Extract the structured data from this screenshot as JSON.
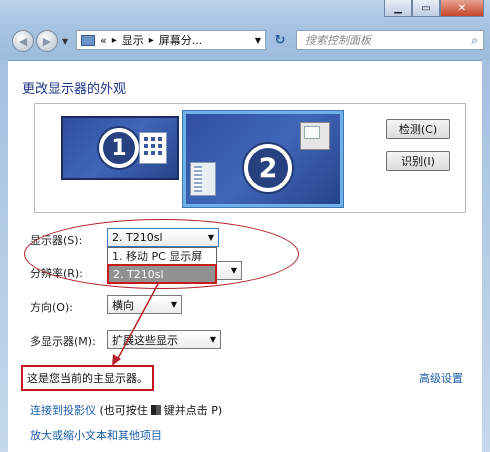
{
  "addressbar": {
    "overflow": "«",
    "crumbs": [
      "显示",
      "屏幕分..."
    ]
  },
  "search": {
    "placeholder": "搜索控制面板"
  },
  "page": {
    "title": "更改显示器的外观"
  },
  "arrangement": {
    "monitor1_number": "1",
    "monitor2_number": "2",
    "detect_label": "检测(C)",
    "identify_label": "识别(I)"
  },
  "settings": {
    "display": {
      "label": "显示器(S):",
      "value": "2. T210sl"
    },
    "display_options": [
      "1. 移动 PC 显示屏",
      "2. T210sl"
    ],
    "resolution": {
      "label": "分辨率(R):"
    },
    "orientation": {
      "label": "方向(O):",
      "value": "横向"
    },
    "multi": {
      "label": "多显示器(M):",
      "value": "扩展这些显示"
    }
  },
  "note": "这是您当前的主显示器。",
  "advanced_link": "高级设置",
  "links": {
    "projector": "连接到投影仪",
    "projector_hint_prefix": "(也可按住",
    "projector_hint_suffix": "键并点击 P)",
    "text_size": "放大或缩小文本和其他项目"
  },
  "colors": {
    "title": "#1e3287",
    "link": "#1b5eab",
    "annotation": "#c4161c",
    "monitor": "#3a5ea8"
  }
}
